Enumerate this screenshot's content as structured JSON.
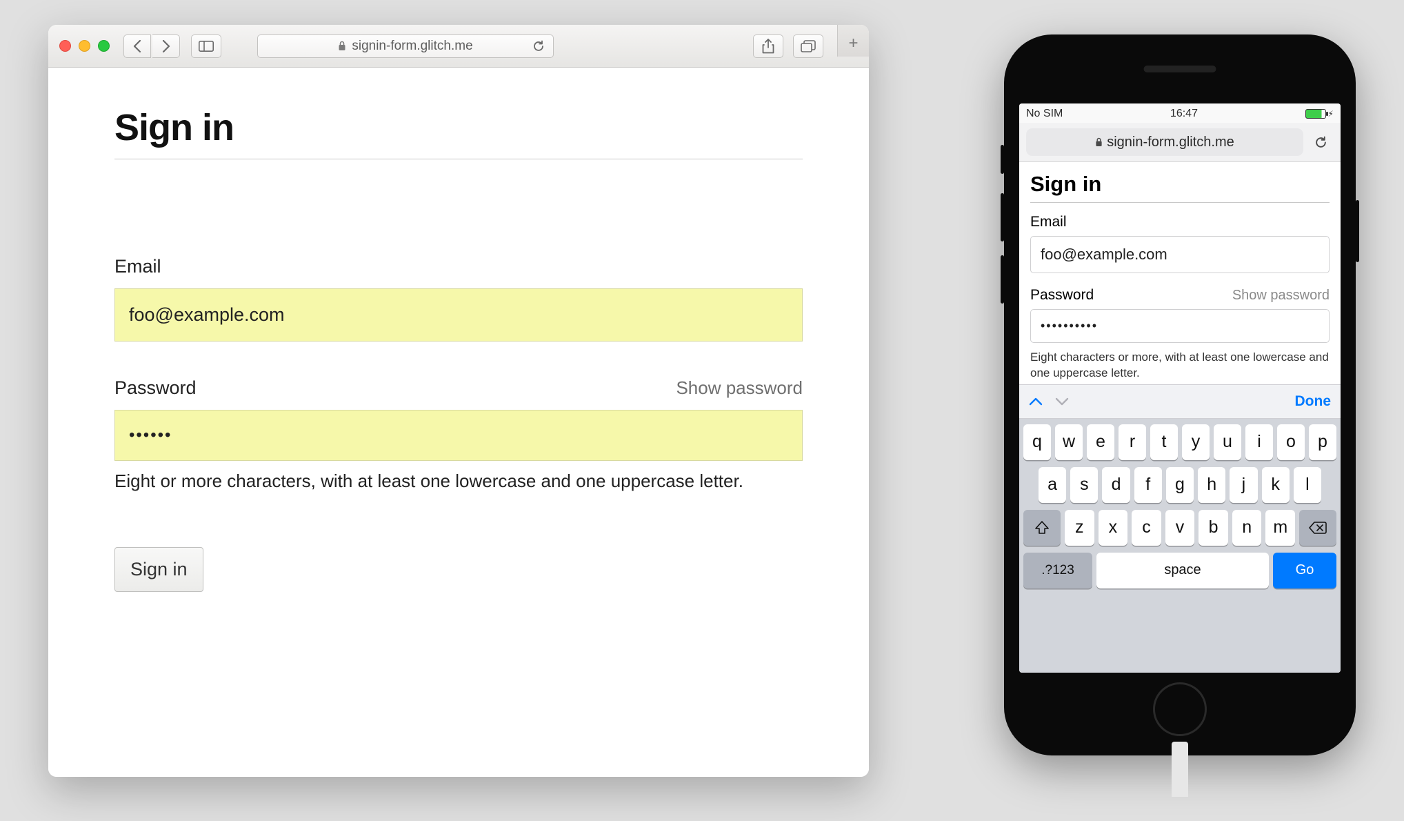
{
  "desktop": {
    "toolbar": {
      "url_display": "signin-form.glitch.me"
    },
    "page": {
      "title": "Sign in",
      "email": {
        "label": "Email",
        "value": "foo@example.com"
      },
      "password": {
        "label": "Password",
        "show_label": "Show password",
        "value": "••••••",
        "hint": "Eight or more characters, with at least one lowercase and one uppercase letter."
      },
      "submit_label": "Sign in"
    }
  },
  "iphone": {
    "status": {
      "carrier": "No SIM",
      "time": "16:47"
    },
    "url_display": "signin-form.glitch.me",
    "page": {
      "title": "Sign in",
      "email": {
        "label": "Email",
        "value": "foo@example.com"
      },
      "password": {
        "label": "Password",
        "show_label": "Show password",
        "value": "••••••••••",
        "hint": "Eight characters or more, with at least one lowercase and one uppercase letter."
      }
    },
    "accessory": {
      "done": "Done"
    },
    "keyboard": {
      "row1": [
        "q",
        "w",
        "e",
        "r",
        "t",
        "y",
        "u",
        "i",
        "o",
        "p"
      ],
      "row2": [
        "a",
        "s",
        "d",
        "f",
        "g",
        "h",
        "j",
        "k",
        "l"
      ],
      "row3": [
        "z",
        "x",
        "c",
        "v",
        "b",
        "n",
        "m"
      ],
      "num_key": ".?123",
      "space_key": "space",
      "go_key": "Go"
    }
  }
}
